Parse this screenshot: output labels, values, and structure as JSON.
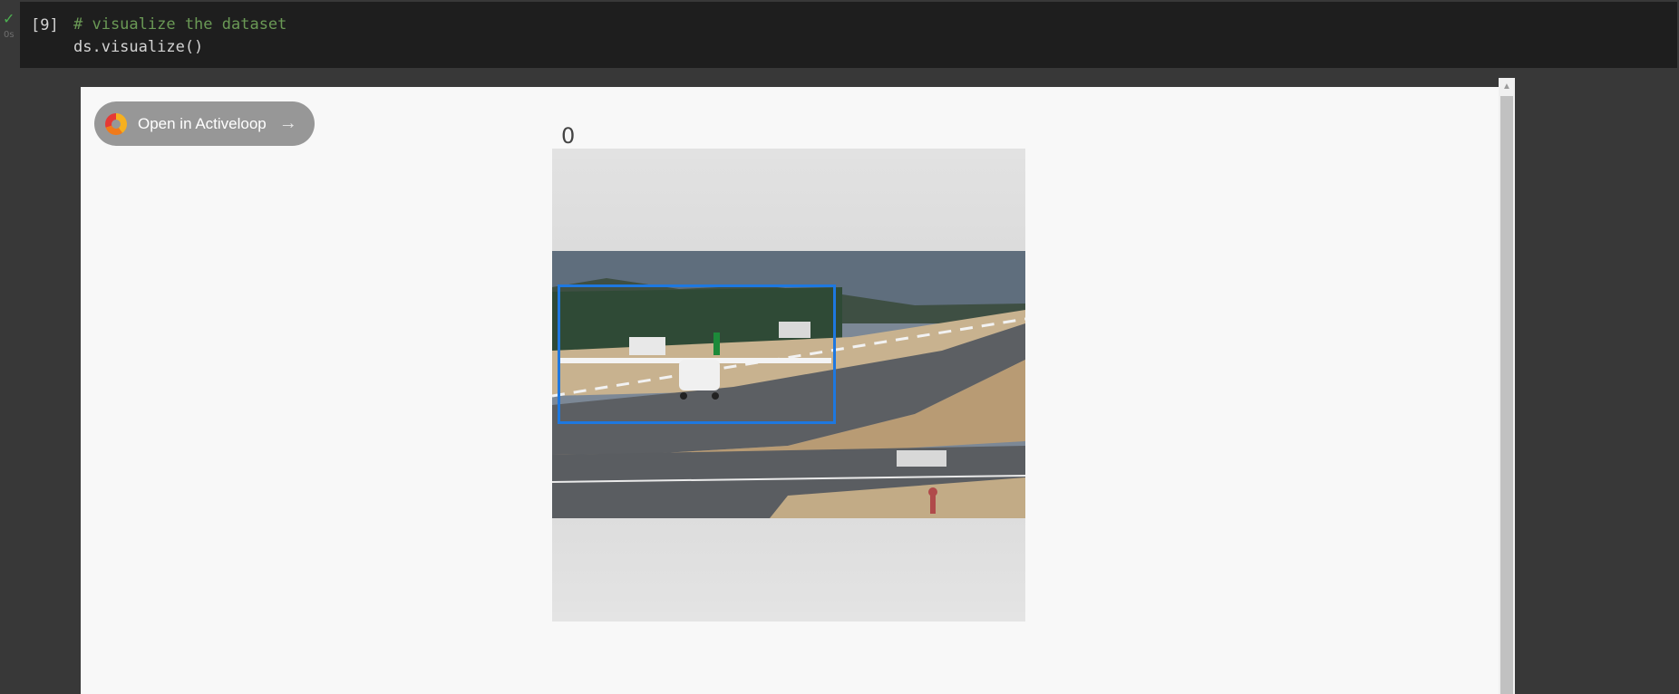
{
  "cell": {
    "status_icon": "check-icon",
    "exec_time": "0s",
    "execution_count": "[9]",
    "code_comment": "# visualize the dataset",
    "code_line": "ds.visualize()"
  },
  "output": {
    "open_button_label": "Open in Activeloop",
    "open_button_icon": "activeloop-logo-icon",
    "arrow_icon": "arrow-right-icon",
    "sample_index": "0"
  },
  "colors": {
    "bbox": "#1e78e0",
    "check": "#4caf50",
    "comment": "#6a9955"
  }
}
